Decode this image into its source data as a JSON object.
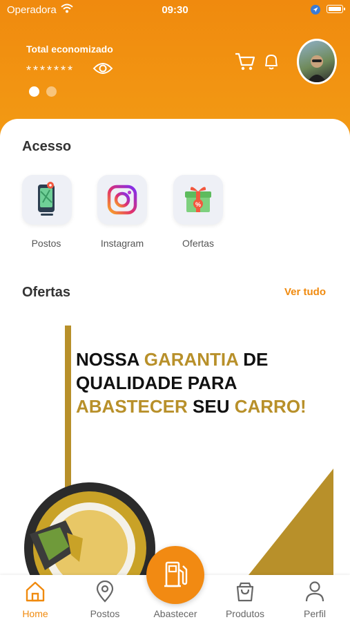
{
  "status_bar": {
    "carrier": "Operadora",
    "time": "09:30"
  },
  "header": {
    "savings_label": "Total economizado",
    "savings_value": "*******",
    "carousel_pages": 2,
    "carousel_active": 1
  },
  "access": {
    "title": "Acesso",
    "items": [
      {
        "label": "Postos",
        "icon": "fuel-map-icon"
      },
      {
        "label": "Instagram",
        "icon": "instagram-icon"
      },
      {
        "label": "Ofertas",
        "icon": "gift-icon"
      }
    ]
  },
  "offers": {
    "title": "Ofertas",
    "see_all": "Ver tudo",
    "banner": {
      "line1_a": "NOSSA ",
      "line1_b": "GARANTIA",
      "line1_c": " DE",
      "line2": "QUALIDADE PARA",
      "line3_a": "ABASTECER",
      "line3_b": " SEU ",
      "line3_c": "CARRO!"
    }
  },
  "tabbar": {
    "items": [
      {
        "label": "Home",
        "icon": "home-icon",
        "active": true
      },
      {
        "label": "Postos",
        "icon": "location-pin-icon",
        "active": false
      },
      {
        "label": "Abastecer",
        "icon": "fuel-pump-icon",
        "active": false
      },
      {
        "label": "Produtos",
        "icon": "shopping-bag-icon",
        "active": false
      },
      {
        "label": "Perfil",
        "icon": "user-icon",
        "active": false
      }
    ]
  },
  "colors": {
    "primary": "#f08a0e",
    "gold": "#b8902a",
    "tile_bg": "#eef0f6"
  }
}
